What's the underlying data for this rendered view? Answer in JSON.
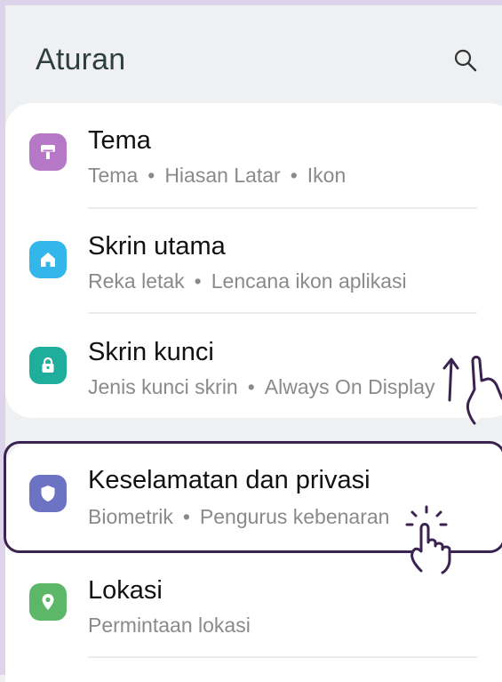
{
  "header": {
    "title": "Aturan",
    "search_icon": "search-icon"
  },
  "colors": {
    "theme_icon": "#b678c6",
    "home_icon": "#33b6ea",
    "lock_icon": "#1fae9b",
    "privacy_icon": "#6c73c2",
    "location_icon": "#5cb868",
    "highlight_border": "#3a2350"
  },
  "items": [
    {
      "title": "Tema",
      "sub": [
        "Tema",
        "Hiasan Latar",
        "Ikon"
      ],
      "icon": "paint-roller-icon"
    },
    {
      "title": "Skrin utama",
      "sub": [
        "Reka letak",
        "Lencana ikon aplikasi"
      ],
      "icon": "home-icon"
    },
    {
      "title": "Skrin kunci",
      "sub": [
        "Jenis kunci skrin",
        "Always On Display"
      ],
      "icon": "lock-icon"
    },
    {
      "title": "Keselamatan dan privasi",
      "sub": [
        "Biometrik",
        "Pengurus kebenaran"
      ],
      "icon": "shield-icon"
    },
    {
      "title": "Lokasi",
      "sub": [
        "Permintaan lokasi"
      ],
      "icon": "location-pin-icon"
    }
  ],
  "separator": "•"
}
